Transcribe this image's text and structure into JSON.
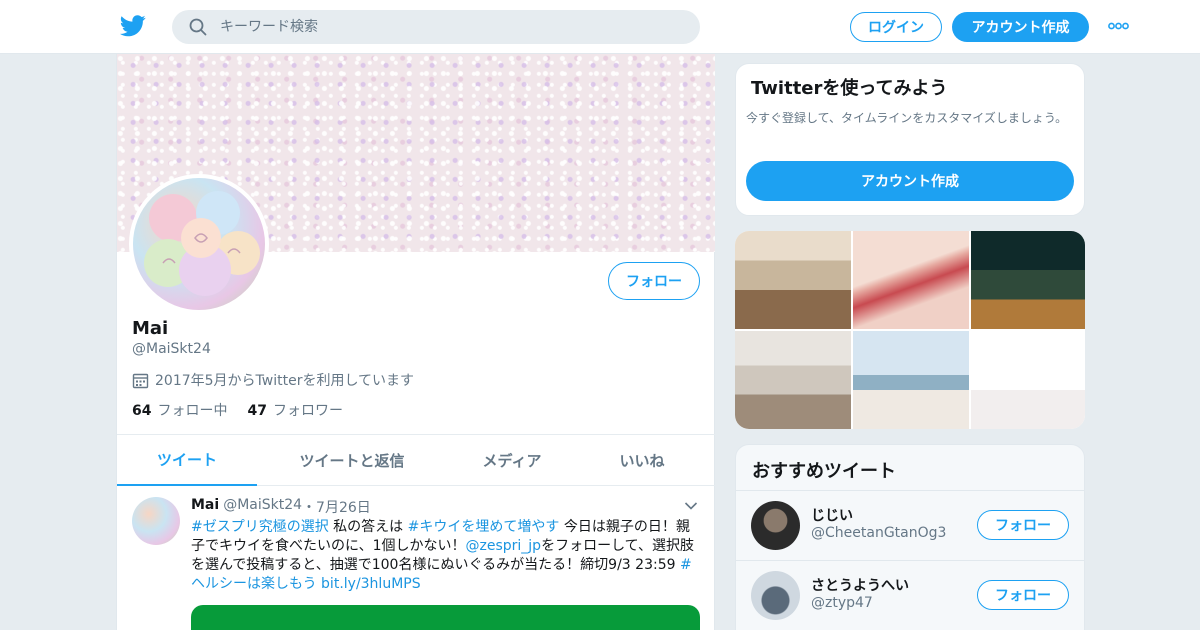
{
  "header": {
    "logo": "twitter-bird-icon",
    "search_placeholder": "キーワード検索",
    "login_label": "ログイン",
    "signup_label": "アカウント作成",
    "more_icon": "more-horizontal-icon"
  },
  "colors": {
    "brand": "#1da1f2",
    "link": "#1b95e0",
    "secondary_text": "#657786",
    "card_green": "#079b3a"
  },
  "profile": {
    "name": "Mai",
    "handle": "@MaiSkt24",
    "joined": "2017年5月からTwitterを利用しています",
    "follow_label": "フォロー",
    "following_count": "64",
    "following_label": "フォロー中",
    "followers_count": "47",
    "followers_label": "フォロワー"
  },
  "tabs": [
    {
      "label": "ツイート",
      "active": true
    },
    {
      "label": "ツイートと返信",
      "active": false
    },
    {
      "label": "メディア",
      "active": false
    },
    {
      "label": "いいね",
      "active": false
    }
  ],
  "tweet": {
    "name": "Mai",
    "handle": "@MaiSkt24",
    "separator": "・",
    "date": "7月26日",
    "segments": [
      {
        "text": "#ゼスプリ究極の選択",
        "link": true
      },
      {
        "text": " 私の答えは ",
        "link": false
      },
      {
        "text": "#キウイを埋めて増やす",
        "link": true
      },
      {
        "text": " 今日は親子の日！親子でキウイを食べたいのに、1個しかない！",
        "link": false
      },
      {
        "text": "@zespri_jp",
        "link": true
      },
      {
        "text": "をフォローして、選択肢を選んで投稿すると、抽選で100名様にぬいぐるみが当たる！締切9/3 23:59 ",
        "link": false
      },
      {
        "text": "#ヘルシーは楽しもう",
        "link": true
      },
      {
        "text": " ",
        "link": false
      },
      {
        "text": "bit.ly/3hluMPS",
        "link": true
      }
    ]
  },
  "signup_card": {
    "title": "Twitterを使ってみよう",
    "description": "今すぐ登録して、タイムラインをカスタマイズしましょう。",
    "button_label": "アカウント作成"
  },
  "recommended": {
    "title": "おすすめツイート",
    "follow_label": "フォロー",
    "users": [
      {
        "name": "じじい",
        "handle": "@CheetanGtanOg3"
      },
      {
        "name": "さとうようへい",
        "handle": "@ztyp47"
      }
    ]
  }
}
